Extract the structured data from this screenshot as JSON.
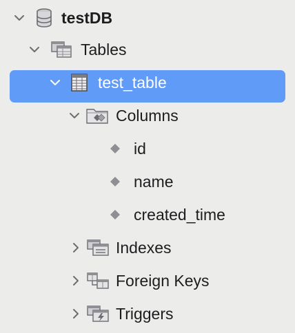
{
  "tree": {
    "database": {
      "label": "testDB",
      "expanded": true,
      "icon": "database-icon"
    },
    "tables_group": {
      "label": "Tables",
      "expanded": true,
      "icon": "tables-folder-icon"
    },
    "table": {
      "label": "test_table",
      "expanded": true,
      "selected": true,
      "icon": "table-grid-icon"
    },
    "columns_group": {
      "label": "Columns",
      "expanded": true,
      "icon": "columns-folder-icon"
    },
    "columns": [
      {
        "label": "id",
        "icon": "column-diamond-icon"
      },
      {
        "label": "name",
        "icon": "column-diamond-icon"
      },
      {
        "label": "created_time",
        "icon": "column-diamond-icon"
      }
    ],
    "indexes_group": {
      "label": "Indexes",
      "expanded": false,
      "icon": "indexes-folder-icon"
    },
    "foreign_keys_group": {
      "label": "Foreign Keys",
      "expanded": false,
      "icon": "foreign-keys-folder-icon"
    },
    "triggers_group": {
      "label": "Triggers",
      "expanded": false,
      "icon": "triggers-folder-icon"
    }
  },
  "colors": {
    "background": "#ececea",
    "selection": "#5f9bf7",
    "text": "#1d1d1f",
    "selected_text": "#ffffff",
    "icon_gray": "#8e8e93"
  }
}
